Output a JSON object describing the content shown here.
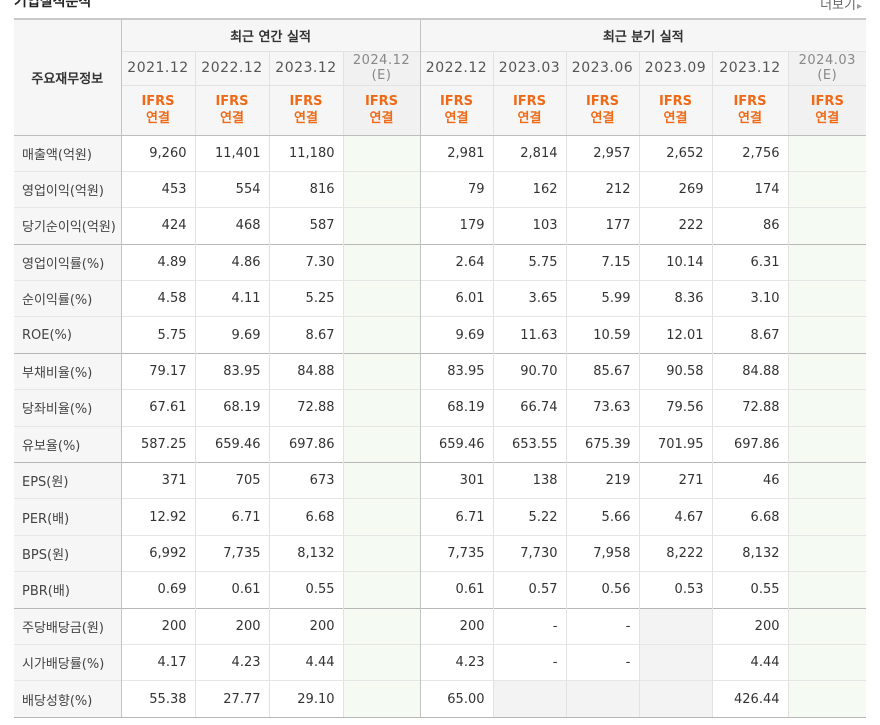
{
  "section": {
    "title": "기업실적분석",
    "more_label": "더보기",
    "more_arrow": "▸"
  },
  "table": {
    "corner_label": "주요재무정보",
    "groups": {
      "annual": "최근 연간 실적",
      "quarterly": "최근 분기 실적"
    },
    "periods": [
      {
        "year": "2021.12",
        "est": "",
        "std": "IFRS",
        "basis": "연결"
      },
      {
        "year": "2022.12",
        "est": "",
        "std": "IFRS",
        "basis": "연결"
      },
      {
        "year": "2023.12",
        "est": "",
        "std": "IFRS",
        "basis": "연결"
      },
      {
        "year": "2024.12",
        "est": "(E)",
        "std": "IFRS",
        "basis": "연결"
      },
      {
        "year": "2022.12",
        "est": "",
        "std": "IFRS",
        "basis": "연결"
      },
      {
        "year": "2023.03",
        "est": "",
        "std": "IFRS",
        "basis": "연결"
      },
      {
        "year": "2023.06",
        "est": "",
        "std": "IFRS",
        "basis": "연결"
      },
      {
        "year": "2023.09",
        "est": "",
        "std": "IFRS",
        "basis": "연결"
      },
      {
        "year": "2023.12",
        "est": "",
        "std": "IFRS",
        "basis": "연결"
      },
      {
        "year": "2024.03",
        "est": "(E)",
        "std": "IFRS",
        "basis": "연결"
      }
    ],
    "rows": [
      {
        "label": "매출액(억원)",
        "values": [
          "9,260",
          "11,401",
          "11,180",
          "",
          "2,981",
          "2,814",
          "2,957",
          "2,652",
          "2,756",
          ""
        ]
      },
      {
        "label": "영업이익(억원)",
        "values": [
          "453",
          "554",
          "816",
          "",
          "79",
          "162",
          "212",
          "269",
          "174",
          ""
        ]
      },
      {
        "label": "당기순이익(억원)",
        "values": [
          "424",
          "468",
          "587",
          "",
          "179",
          "103",
          "177",
          "222",
          "86",
          ""
        ]
      },
      {
        "label": "영업이익률(%)",
        "values": [
          "4.89",
          "4.86",
          "7.30",
          "",
          "2.64",
          "5.75",
          "7.15",
          "10.14",
          "6.31",
          ""
        ]
      },
      {
        "label": "순이익률(%)",
        "values": [
          "4.58",
          "4.11",
          "5.25",
          "",
          "6.01",
          "3.65",
          "5.99",
          "8.36",
          "3.10",
          ""
        ]
      },
      {
        "label": "ROE(%)",
        "values": [
          "5.75",
          "9.69",
          "8.67",
          "",
          "9.69",
          "11.63",
          "10.59",
          "12.01",
          "8.67",
          ""
        ]
      },
      {
        "label": "부채비율(%)",
        "values": [
          "79.17",
          "83.95",
          "84.88",
          "",
          "83.95",
          "90.70",
          "85.67",
          "90.58",
          "84.88",
          ""
        ]
      },
      {
        "label": "당좌비율(%)",
        "values": [
          "67.61",
          "68.19",
          "72.88",
          "",
          "68.19",
          "66.74",
          "73.63",
          "79.56",
          "72.88",
          ""
        ]
      },
      {
        "label": "유보율(%)",
        "values": [
          "587.25",
          "659.46",
          "697.86",
          "",
          "659.46",
          "653.55",
          "675.39",
          "701.95",
          "697.86",
          ""
        ]
      },
      {
        "label": "EPS(원)",
        "values": [
          "371",
          "705",
          "673",
          "",
          "301",
          "138",
          "219",
          "271",
          "46",
          ""
        ]
      },
      {
        "label": "PER(배)",
        "values": [
          "12.92",
          "6.71",
          "6.68",
          "",
          "6.71",
          "5.22",
          "5.66",
          "4.67",
          "6.68",
          ""
        ]
      },
      {
        "label": "BPS(원)",
        "values": [
          "6,992",
          "7,735",
          "8,132",
          "",
          "7,735",
          "7,730",
          "7,958",
          "8,222",
          "8,132",
          ""
        ]
      },
      {
        "label": "PBR(배)",
        "values": [
          "0.69",
          "0.61",
          "0.55",
          "",
          "0.61",
          "0.57",
          "0.56",
          "0.53",
          "0.55",
          ""
        ]
      },
      {
        "label": "주당배당금(원)",
        "values": [
          "200",
          "200",
          "200",
          "",
          "200",
          "-",
          "-",
          "",
          "200",
          ""
        ]
      },
      {
        "label": "시가배당률(%)",
        "values": [
          "4.17",
          "4.23",
          "4.44",
          "",
          "4.23",
          "-",
          "-",
          "",
          "4.44",
          ""
        ]
      },
      {
        "label": "배당성향(%)",
        "values": [
          "55.38",
          "27.77",
          "29.10",
          "",
          "65.00",
          "",
          "",
          "",
          "426.44",
          ""
        ]
      }
    ],
    "group_breaks": [
      3,
      6,
      9,
      13
    ],
    "shaded_empty_cells": [
      [
        13,
        7
      ],
      [
        14,
        7
      ],
      [
        15,
        5
      ],
      [
        15,
        6
      ],
      [
        15,
        7
      ]
    ],
    "colors": {
      "ifrs_orange": "#ee6a17",
      "estimate_green_tint": "#f5faf2",
      "header_gray": "#f6f6f6"
    }
  }
}
